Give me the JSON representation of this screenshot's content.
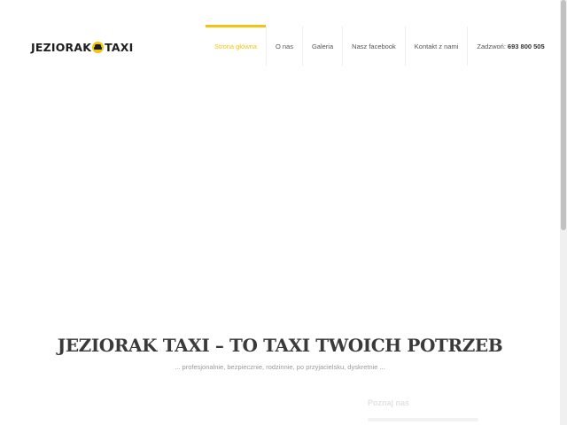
{
  "logo": {
    "left_text": "JEZIORAK",
    "right_text": "TAXI",
    "icon": "taxi-icon"
  },
  "nav": {
    "items": [
      {
        "label": "Strona główna",
        "active": true
      },
      {
        "label": "O nas"
      },
      {
        "label": "Galeria"
      },
      {
        "label": "Nasz facebook"
      },
      {
        "label": "Kontakt z nami"
      }
    ],
    "phone_label": "Zadzwoń:",
    "phone_number": "693 800 505"
  },
  "hero": {
    "title": "JEZIORAK TAXI – TO TAXI TWOICH POTRZEB",
    "subtitle": "... profesjonalnie, bezpiecznie, rodzinnie, po przyjacielsku, dyskretnie ..."
  },
  "section": {
    "heading": "Poznaj nas"
  },
  "colors": {
    "accent": "#f1c40f",
    "title": "#3a3a3a",
    "text": "#555555"
  }
}
